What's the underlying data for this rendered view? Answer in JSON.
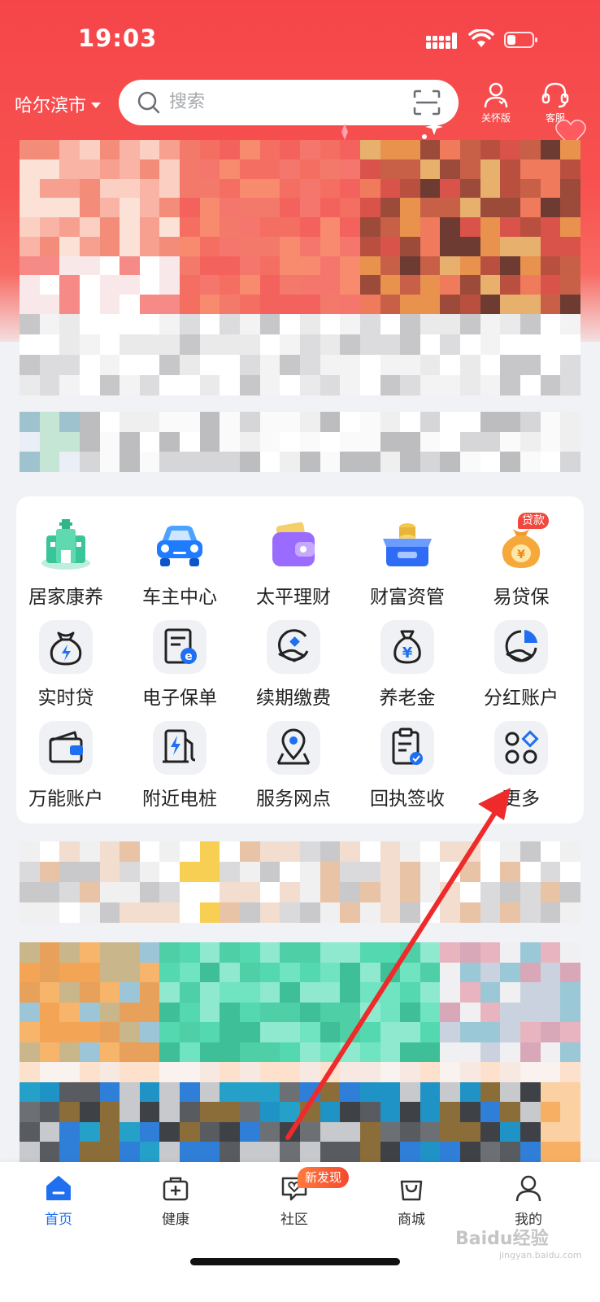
{
  "status": {
    "time": "19:03"
  },
  "header": {
    "city": "哈尔滨市",
    "search_placeholder": "搜索",
    "care_mode": "关怀版",
    "service": "客服"
  },
  "services": [
    {
      "label": "居家康养",
      "icon": "home-care-icon"
    },
    {
      "label": "车主中心",
      "icon": "car-icon"
    },
    {
      "label": "太平理财",
      "icon": "wallet-icon"
    },
    {
      "label": "财富资管",
      "icon": "treasure-box-icon"
    },
    {
      "label": "易贷保",
      "icon": "money-bag-icon",
      "badge": "贷款"
    },
    {
      "label": "实时贷",
      "icon": "loan-bag-icon"
    },
    {
      "label": "电子保单",
      "icon": "e-policy-icon"
    },
    {
      "label": "续期缴费",
      "icon": "renewal-payment-icon"
    },
    {
      "label": "养老金",
      "icon": "pension-icon"
    },
    {
      "label": "分红账户",
      "icon": "dividend-account-icon"
    },
    {
      "label": "万能账户",
      "icon": "universal-account-icon"
    },
    {
      "label": "附近电桩",
      "icon": "charging-station-icon"
    },
    {
      "label": "服务网点",
      "icon": "service-outlet-icon"
    },
    {
      "label": "回执签收",
      "icon": "receipt-sign-icon"
    },
    {
      "label": "更多",
      "icon": "more-icon"
    }
  ],
  "tabs": [
    {
      "label": "首页",
      "active": true
    },
    {
      "label": "健康",
      "active": false
    },
    {
      "label": "社区",
      "active": false,
      "badge": "新发现"
    },
    {
      "label": "商城",
      "active": false
    },
    {
      "label": "我的",
      "active": false
    }
  ],
  "watermark": {
    "text": "Baidu经验",
    "sub": "jingyan.baidu.com"
  },
  "colors": {
    "brand_red": "#f5454a",
    "accent_blue": "#1f6ff0",
    "arrow_red": "#ee2a2a"
  }
}
